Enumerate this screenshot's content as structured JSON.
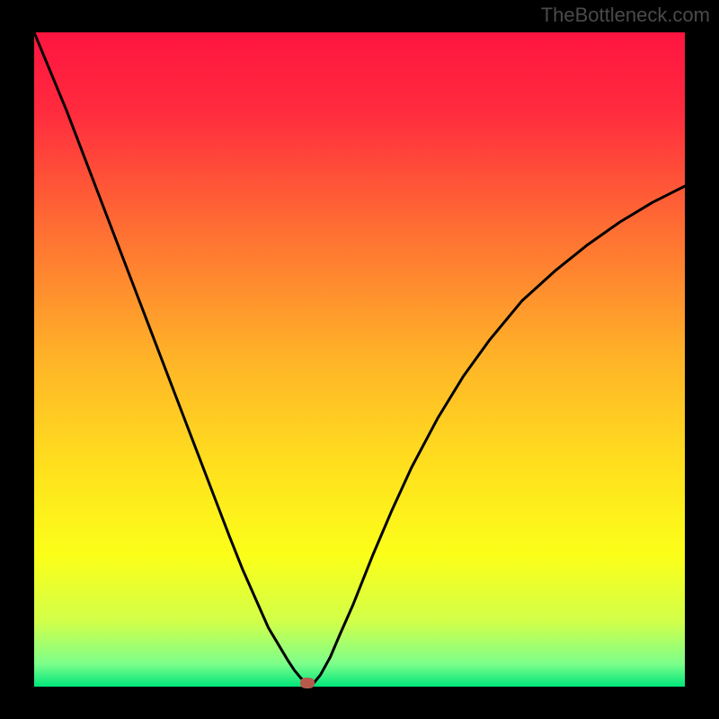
{
  "watermark": "TheBottleneck.com",
  "chart_data": {
    "type": "line",
    "title": "",
    "xlabel": "",
    "ylabel": "",
    "xlim": [
      0,
      100
    ],
    "ylim": [
      0,
      100
    ],
    "grid": false,
    "legend": false,
    "background": {
      "type": "vertical_gradient",
      "stops": [
        {
          "pos": 0.0,
          "color": "#ff1440"
        },
        {
          "pos": 0.12,
          "color": "#ff2b3e"
        },
        {
          "pos": 0.3,
          "color": "#ff6e33"
        },
        {
          "pos": 0.5,
          "color": "#ffb428"
        },
        {
          "pos": 0.68,
          "color": "#ffe41d"
        },
        {
          "pos": 0.8,
          "color": "#fbff19"
        },
        {
          "pos": 0.9,
          "color": "#d2ff49"
        },
        {
          "pos": 0.965,
          "color": "#7dff8b"
        },
        {
          "pos": 1.0,
          "color": "#00e67a"
        }
      ]
    },
    "series": [
      {
        "name": "bottleneck-curve",
        "color": "#000000",
        "x": [
          0.0,
          2.5,
          5.0,
          7.5,
          10.0,
          12.5,
          15.0,
          17.5,
          20.0,
          22.5,
          25.0,
          27.5,
          30.0,
          32.0,
          34.0,
          36.0,
          37.5,
          39.0,
          40.0,
          41.0,
          42.0,
          43.0,
          44.0,
          45.5,
          47.0,
          49.0,
          52.0,
          55.0,
          58.0,
          62.0,
          66.0,
          70.0,
          75.0,
          80.0,
          85.0,
          90.0,
          95.0,
          100.0
        ],
        "y": [
          100.0,
          94.0,
          88.0,
          81.5,
          75.0,
          68.5,
          62.0,
          55.5,
          49.0,
          42.5,
          36.0,
          29.5,
          23.0,
          18.0,
          13.5,
          9.0,
          6.5,
          4.0,
          2.5,
          1.3,
          0.5,
          0.6,
          1.8,
          4.5,
          8.0,
          12.5,
          20.0,
          27.0,
          33.5,
          41.0,
          47.5,
          53.0,
          59.0,
          63.5,
          67.5,
          71.0,
          74.0,
          76.5
        ]
      }
    ],
    "markers": [
      {
        "name": "bottleneck-point",
        "x": 42.0,
        "y": 0.5,
        "color": "#b75a4c"
      }
    ]
  }
}
